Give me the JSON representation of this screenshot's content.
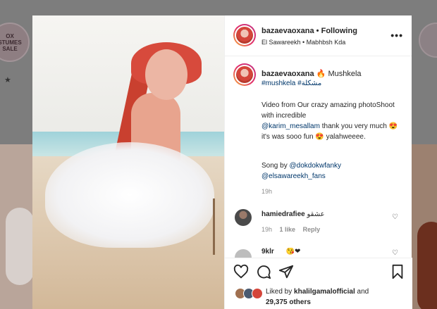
{
  "background": {
    "profile_badge": "OX\nSTUMES\nSALE",
    "star": "★"
  },
  "post": {
    "username": "bazaevaoxana",
    "follow_label": "Following",
    "location": "El Sawareekh • Mabhbsh Kda",
    "more_icon": "more-horizontal-icon"
  },
  "caption": {
    "username": "bazaevaoxana",
    "emoji": "🔥",
    "title": "Mushkela",
    "hashtags": "#mushkela #مشكلة",
    "body_1": "Video from Our crazy amazing photoShoot with incredible",
    "mention_1": "@karim_mesallam",
    "body_2": " thank you very much 😍 it's was sooo fun 😍 yalahweeee.",
    "song_prefix": "Song by ",
    "mention_2": "@dokdokwfanky",
    "mention_3": "@elsawareekh_fans",
    "time": "19h"
  },
  "comments": [
    {
      "username": "hamiedrafiee",
      "text": "عشقو",
      "time": "19h",
      "likes": "1 like",
      "reply_label": "Reply"
    },
    {
      "username": "9klr",
      "text": "😘❤"
    }
  ],
  "actions": {
    "like_icon": "heart-icon",
    "comment_icon": "comment-icon",
    "share_icon": "share-icon",
    "save_icon": "bookmark-icon"
  },
  "likes": {
    "prefix": "Liked by ",
    "user": "khalilgamalofficial",
    "suffix": " and",
    "count": "29,375 others"
  },
  "colors": {
    "link": "#00376b",
    "muted": "#8e8e8e",
    "text": "#262626"
  }
}
